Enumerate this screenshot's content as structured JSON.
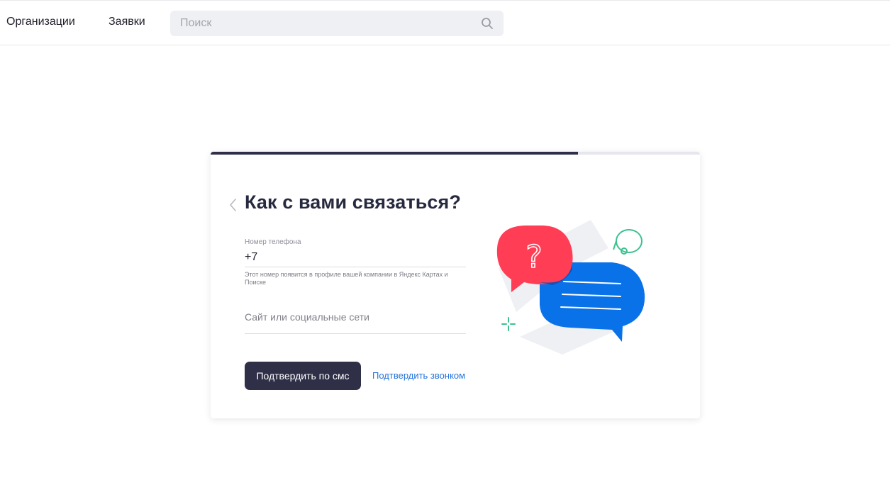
{
  "header": {
    "nav": [
      {
        "label": "Организации"
      },
      {
        "label": "Заявки"
      }
    ],
    "search": {
      "placeholder": "Поиск",
      "value": "",
      "icon": "search-icon"
    }
  },
  "card": {
    "progress_fraction": 0.75,
    "title": "Как с вами связаться?",
    "phone": {
      "label": "Номер телефона",
      "value": "+7",
      "hint": "Этот номер появится в профиле вашей компании в Яндекс Картах и Поиске"
    },
    "site": {
      "placeholder": "Сайт или социальные сети",
      "value": ""
    },
    "confirm_sms_label": "Подтвердить по смс",
    "confirm_call_label": "Подтвердить звонком",
    "illustration": {
      "name": "chat-bubbles-illustration",
      "question_mark": "?"
    }
  },
  "colors": {
    "accent_dark": "#2f3048",
    "link": "#2574d9",
    "bubble_red": "#ff3d55",
    "bubble_blue": "#0a72e9",
    "headset_green": "#3bc28e"
  }
}
